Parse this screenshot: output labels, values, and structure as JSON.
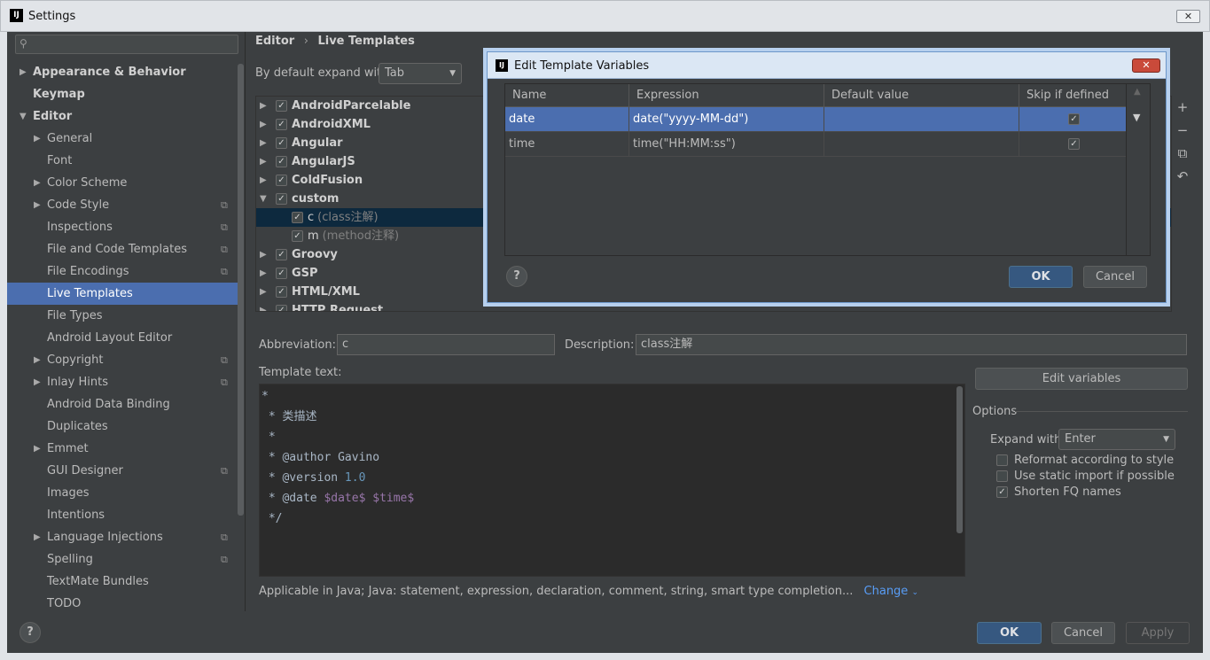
{
  "window": {
    "title": "Settings",
    "close_label": "✕"
  },
  "search": {
    "placeholder": ""
  },
  "sidebar": {
    "items": [
      {
        "label": "Appearance & Behavior",
        "bold": true,
        "arrow": "▶"
      },
      {
        "label": "Keymap",
        "bold": true
      },
      {
        "label": "Editor",
        "bold": true,
        "arrow": "▼"
      },
      {
        "label": "General",
        "arrow": "▶"
      },
      {
        "label": "Font"
      },
      {
        "label": "Color Scheme",
        "arrow": "▶"
      },
      {
        "label": "Code Style",
        "arrow": "▶",
        "copy": true
      },
      {
        "label": "Inspections",
        "copy": true
      },
      {
        "label": "File and Code Templates",
        "copy": true
      },
      {
        "label": "File Encodings",
        "copy": true
      },
      {
        "label": "Live Templates",
        "selected": true
      },
      {
        "label": "File Types"
      },
      {
        "label": "Android Layout Editor"
      },
      {
        "label": "Copyright",
        "arrow": "▶",
        "copy": true
      },
      {
        "label": "Inlay Hints",
        "arrow": "▶",
        "copy": true
      },
      {
        "label": "Android Data Binding"
      },
      {
        "label": "Duplicates"
      },
      {
        "label": "Emmet",
        "arrow": "▶"
      },
      {
        "label": "GUI Designer",
        "copy": true
      },
      {
        "label": "Images"
      },
      {
        "label": "Intentions"
      },
      {
        "label": "Language Injections",
        "arrow": "▶",
        "copy": true
      },
      {
        "label": "Spelling",
        "copy": true
      },
      {
        "label": "TextMate Bundles"
      },
      {
        "label": "TODO"
      }
    ]
  },
  "breadcrumb": {
    "parent": "Editor",
    "separator": "›",
    "current": "Live Templates"
  },
  "expand": {
    "label": "By default expand with",
    "value": "Tab"
  },
  "tree": {
    "nodes": [
      {
        "label": "AndroidParcelable"
      },
      {
        "label": "AndroidXML"
      },
      {
        "label": "Angular"
      },
      {
        "label": "AngularJS"
      },
      {
        "label": "ColdFusion"
      },
      {
        "label": "custom",
        "expanded": true
      },
      {
        "label": "c",
        "desc": "(class注解)",
        "child": true,
        "selected": true
      },
      {
        "label": "m",
        "desc": "(method注释)",
        "child": true
      },
      {
        "label": "Groovy"
      },
      {
        "label": "GSP"
      },
      {
        "label": "HTML/XML"
      },
      {
        "label": "HTTP Request"
      }
    ],
    "buttons": [
      "+",
      "−",
      "⧉",
      "↶"
    ]
  },
  "abbreviation": {
    "label": "Abbreviation:",
    "value": "c"
  },
  "description": {
    "label": "Description:",
    "value": "class注解"
  },
  "template": {
    "label": "Template text:",
    "lines": [
      [
        {
          "t": "*"
        }
      ],
      [
        {
          "t": " * 类描述"
        }
      ],
      [
        {
          "t": " *"
        }
      ],
      [
        {
          "t": " * @author Gavino"
        }
      ],
      [
        {
          "t": " * @version "
        },
        {
          "t": "1.0",
          "c": "num"
        }
      ],
      [
        {
          "t": " * @date "
        },
        {
          "t": "$date$",
          "c": "var"
        },
        {
          "t": " "
        },
        {
          "t": "$time$",
          "c": "var"
        }
      ],
      [
        {
          "t": " */"
        }
      ]
    ]
  },
  "edit_variables_label": "Edit variables",
  "options": {
    "title": "Options",
    "expand_label": "Expand with",
    "expand_value": "Enter",
    "checks": [
      {
        "label": "Reformat according to style",
        "checked": false
      },
      {
        "label": "Use static import if possible",
        "checked": false
      },
      {
        "label": "Shorten FQ names",
        "checked": true
      }
    ]
  },
  "applicable": {
    "text": "Applicable in Java; Java: statement, expression, declaration, comment, string, smart type completion...",
    "change_label": "Change"
  },
  "footer": {
    "help": "?",
    "ok": "OK",
    "cancel": "Cancel",
    "apply": "Apply"
  },
  "dialog": {
    "title": "Edit Template Variables",
    "close_label": "✕",
    "columns": [
      "Name",
      "Expression",
      "Default value",
      "Skip if defined"
    ],
    "rows": [
      {
        "name": "date",
        "expression": "date(\"yyyy-MM-dd\")",
        "default": "",
        "skip": true
      },
      {
        "name": "time",
        "expression": "time(\"HH:MM:ss\")",
        "default": "",
        "skip": true
      }
    ],
    "help": "?",
    "ok": "OK",
    "cancel": "Cancel"
  },
  "colors": {
    "accent": "#4b6eaf",
    "background": "#3c3f41",
    "editor": "#2b2b2b",
    "link": "#589df6"
  }
}
